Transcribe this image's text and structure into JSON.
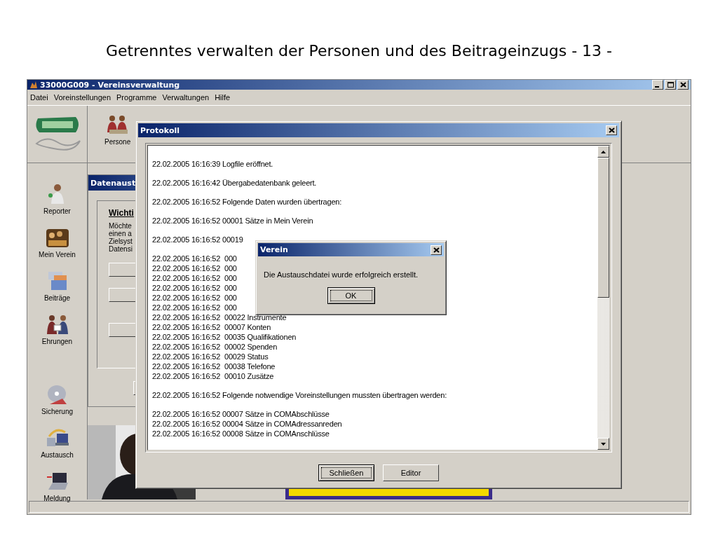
{
  "slide": {
    "title": "Getrenntes verwalten der Personen und des Beitrageinzugs - 13 -"
  },
  "window": {
    "title": "33000G009 - Vereinsverwaltung"
  },
  "menu": [
    "Datei",
    "Voreinstellungen",
    "Programme",
    "Verwaltungen",
    "Hilfe"
  ],
  "toolbar": {
    "items": [
      {
        "label": "Persone"
      }
    ]
  },
  "sidebar": {
    "groups": [
      [
        {
          "label": "Reporter",
          "kind": "reporter"
        },
        {
          "label": "Mein Verein",
          "kind": "club"
        },
        {
          "label": "Beiträge",
          "kind": "money"
        },
        {
          "label": "Ehrungen",
          "kind": "award"
        }
      ],
      [
        {
          "label": "Sicherung",
          "kind": "disc"
        },
        {
          "label": "Austausch",
          "kind": "exchange"
        },
        {
          "label": "Meldung",
          "kind": "laptop"
        }
      ]
    ]
  },
  "panel": {
    "title": "Datenaust",
    "heading": "Wichti",
    "lines": [
      "Möchte",
      "einen a",
      "Zielsyst",
      "Datensi"
    ]
  },
  "protocol": {
    "title": "Protokoll",
    "groups": [
      [
        {
          "kind": "plain",
          "text": "22.02.2005 16:16:39 Logfile eröffnet."
        }
      ],
      [
        {
          "kind": "plain",
          "text": "22.02.2005 16:16:42 Übergabedatenbank geleert."
        }
      ],
      [
        {
          "kind": "plain",
          "text": "22.02.2005 16:16:52 Folgende Daten wurden übertragen:"
        }
      ],
      [
        {
          "kind": "plain",
          "text": "22.02.2005 16:16:52 00001  Sätze in  Mein Verein"
        }
      ],
      [
        {
          "kind": "plain",
          "text": "22.02.2005 16:16:52 00019"
        }
      ],
      [
        {
          "kind": "column",
          "time": "22.02.2005 16:16:52",
          "text": "000"
        },
        {
          "kind": "column",
          "time": "22.02.2005 16:16:52",
          "text": "000"
        },
        {
          "kind": "column",
          "time": "22.02.2005 16:16:52",
          "text": "000"
        },
        {
          "kind": "column",
          "time": "22.02.2005 16:16:52",
          "text": "000"
        },
        {
          "kind": "column",
          "time": "22.02.2005 16:16:52",
          "text": "000"
        },
        {
          "kind": "column",
          "time": "22.02.2005 16:16:52",
          "text": "000"
        },
        {
          "kind": "column",
          "time": "22.02.2005 16:16:52",
          "text": "00022 Instrumente"
        },
        {
          "kind": "column",
          "time": "22.02.2005 16:16:52",
          "text": "00007 Konten"
        },
        {
          "kind": "column",
          "time": "22.02.2005 16:16:52",
          "text": "00035 Qualifikationen"
        },
        {
          "kind": "column",
          "time": "22.02.2005 16:16:52",
          "text": "00002 Spenden"
        },
        {
          "kind": "column",
          "time": "22.02.2005 16:16:52",
          "text": "00029 Status"
        },
        {
          "kind": "column",
          "time": "22.02.2005 16:16:52",
          "text": "00038 Telefone"
        },
        {
          "kind": "column",
          "time": "22.02.2005 16:16:52",
          "text": "00010 Zusätze"
        }
      ],
      [
        {
          "kind": "plain",
          "text": "22.02.2005 16:16:52 Folgende notwendige Voreinstellungen mussten übertragen werden:"
        }
      ],
      [
        {
          "kind": "plain",
          "text": "22.02.2005 16:16:52 00007  Sätze in  COMAbschlüsse"
        },
        {
          "kind": "plain",
          "text": "22.02.2005 16:16:52 00004  Sätze in  COMAdressanreden"
        },
        {
          "kind": "plain",
          "text": "22.02.2005 16:16:52 00008  Sätze in  COMAnschlüsse"
        }
      ]
    ],
    "buttons": [
      {
        "label": "Schließen",
        "default": true
      },
      {
        "label": "Editor",
        "default": false
      }
    ]
  },
  "message": {
    "title": "Verein",
    "text": "Die Austauschdatei wurde erfolgreich erstellt.",
    "button": "OK"
  }
}
